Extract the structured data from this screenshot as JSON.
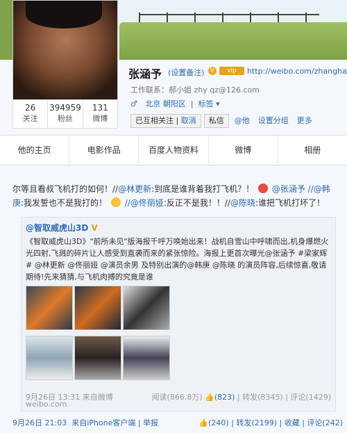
{
  "profile": {
    "name": "张涵予",
    "set_note": "(设置备注)",
    "vip_label": "V",
    "url": "http://weibo.com/zhanghanyu",
    "contact": "工作联系：郝小姐 zhy qz@126.com",
    "gender": "♂",
    "location": "北京 朝阳区",
    "tags": "标签",
    "stats": [
      {
        "value": "26",
        "label": "关注"
      },
      {
        "value": "394959",
        "label": "粉丝"
      },
      {
        "value": "131",
        "label": "微博"
      }
    ],
    "buttons": {
      "follow": "已互相关注",
      "unfollow": "取消",
      "message": "私信",
      "at": "@他",
      "group": "设置分组",
      "more": "更多"
    }
  },
  "tabs": [
    "他的主页",
    "电影作品",
    "百度人物资料",
    "微博",
    "相册"
  ],
  "post": {
    "text_1": "尔等且看叔飞机打的如何！//",
    "mention_1": "@林更新",
    "text_2": ":到底是谁背着我打飞机？！",
    "mention_2": "@张涵予",
    "mention_3": "//@韩庚",
    "text_3": ":我发誓也不是我打的！",
    "mention_4": "//@佟丽娅",
    "text_4": ":反正不是我！！//",
    "mention_5": "@陈晓",
    "text_5": ":谁把飞机打坏了！",
    "timestamp": "9月26日 21:03",
    "source": "来自iPhone客户端",
    "report": "举报",
    "likes": "(240)",
    "reposts": "转发(2199)",
    "favorites": "收藏",
    "comments": "评论(242)"
  },
  "quote": {
    "title": "@智取威虎山3D",
    "v": "V",
    "text": "《智取威虎山3D》\"前所未见\"版海报千呼万唤始出来！战机自雪山中呼啸而出,机身爆燃火光四射,飞溅的碎片让人感受到直袭而来的紧张惊险。海报上更首次曝光@张涵予 #梁家辉# @林更新 @佟丽娅 @演员余男 及特别出演的@韩庚 @陈晓 的演员阵容,后续惊喜,敬请期待!先来猜猜,与飞机肉搏的究竟是谁",
    "timestamp": "9月26日 13:31",
    "source": "来自微博",
    "src_site": "weibo.com",
    "reads": "阅读(866.8万)",
    "likes": "(823)",
    "reposts": "转发(8345)",
    "comments": "评论(1429)"
  }
}
